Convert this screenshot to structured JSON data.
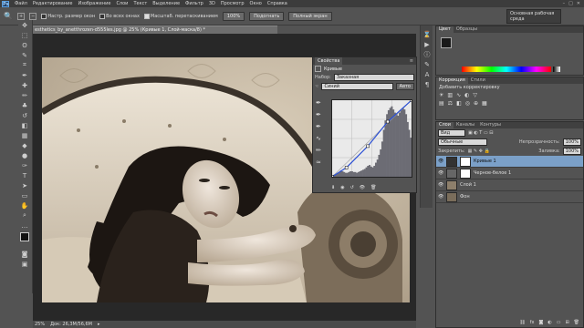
{
  "menubar": {
    "logo": "Ps",
    "items": [
      "Файл",
      "Редактирование",
      "Изображение",
      "Слои",
      "Текст",
      "Выделение",
      "Фильтр",
      "3D",
      "Просмотр",
      "Окно",
      "Справка"
    ],
    "win_controls": [
      "–",
      "□",
      "✕"
    ]
  },
  "options": {
    "zoom_icon": "magnifier-icon",
    "check1": "Настр. размер окон",
    "check2": "Во всех окнах",
    "check3": "Масштаб. перетаскиванием",
    "btn1": "100%",
    "btn2": "Подогнать",
    "btn3": "Полный экран",
    "workspace": "Основная рабочая среда"
  },
  "document": {
    "tab": "esthetics_by_anetthrozen-d555les.jpg @ 25% (Кривые 1, Слой-маска/8) *",
    "status_zoom": "25%",
    "status_doc": "Док: 26,3M/56,6M"
  },
  "properties": {
    "tabs": [
      "Свойства"
    ],
    "title": "Кривые",
    "preset_label": "Набор:",
    "preset_value": "Заказная",
    "channel_value": "Синий",
    "auto_label": "Авто",
    "curve_points": [
      [
        0,
        0
      ],
      [
        0.18,
        0.12
      ],
      [
        0.45,
        0.4
      ],
      [
        0.7,
        0.72
      ],
      [
        1,
        1
      ]
    ],
    "histogram": [
      2,
      3,
      4,
      5,
      6,
      8,
      7,
      6,
      5,
      5,
      6,
      7,
      7,
      6,
      6,
      5,
      6,
      7,
      8,
      9,
      10,
      12,
      14,
      15,
      13,
      12,
      14,
      18,
      22,
      28,
      35,
      45,
      60,
      72,
      80,
      85,
      88,
      90,
      86,
      82,
      80,
      78,
      82,
      85,
      88,
      86,
      80,
      70,
      60,
      50
    ]
  },
  "color_panel": {
    "tabs": [
      "Цвет",
      "Образцы"
    ],
    "fg": "#1a1a1a",
    "bg": "#ffffff"
  },
  "adjust_panel": {
    "tabs": [
      "Коррекция",
      "Стили"
    ],
    "title": "Добавить корректировку"
  },
  "layers_panel": {
    "tabs": [
      "Слои",
      "Каналы",
      "Контуры"
    ],
    "filter_label": "Вид",
    "blend_mode": "Обычные",
    "opacity_label": "Непрозрачность:",
    "opacity": "100%",
    "lock_label": "Закрепить:",
    "fill_label": "Заливка:",
    "fill": "100%",
    "layers": [
      {
        "name": "Кривые 1",
        "selected": true
      },
      {
        "name": "Черное-белое 1",
        "selected": false
      },
      {
        "name": "Слой 1",
        "selected": false
      },
      {
        "name": "Фон",
        "selected": false
      }
    ]
  }
}
